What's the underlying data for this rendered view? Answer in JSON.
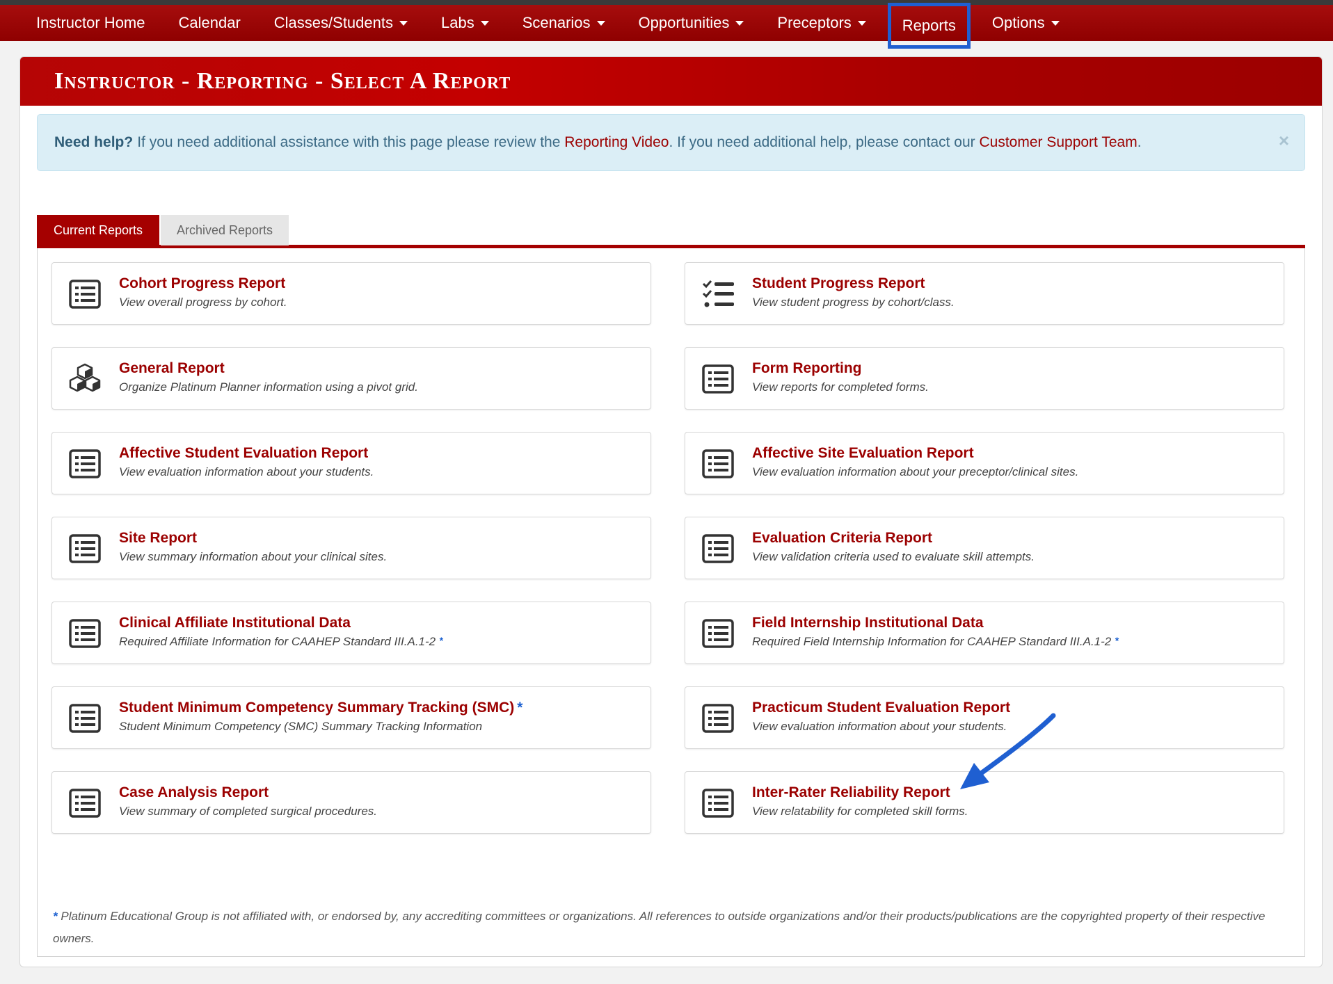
{
  "nav": {
    "items": [
      {
        "label": "Instructor Home",
        "dropdown": false
      },
      {
        "label": "Calendar",
        "dropdown": false
      },
      {
        "label": "Classes/Students",
        "dropdown": true
      },
      {
        "label": "Labs",
        "dropdown": true
      },
      {
        "label": "Scenarios",
        "dropdown": true
      },
      {
        "label": "Opportunities",
        "dropdown": true
      },
      {
        "label": "Preceptors",
        "dropdown": true
      },
      {
        "label": "Reports",
        "dropdown": false,
        "highlighted": true
      },
      {
        "label": "Options",
        "dropdown": true
      }
    ]
  },
  "page": {
    "title": "Instructor - Reporting - Select A Report"
  },
  "alert": {
    "lead": "Need help?",
    "text1": "If you need additional assistance with this page please review the",
    "link1": "Reporting Video",
    "text2": ". If you need additional help, please contact our",
    "link2": "Customer Support Team",
    "text3": ".",
    "close": "×"
  },
  "tabs": {
    "current": "Current Reports",
    "archived": "Archived Reports"
  },
  "reports": [
    {
      "title": "Cohort Progress Report",
      "desc": "View overall progress by cohort.",
      "icon": "list-alt-icon",
      "star": ""
    },
    {
      "title": "Student Progress Report",
      "desc": "View student progress by cohort/class.",
      "icon": "tasks-icon",
      "star": ""
    },
    {
      "title": "General Report",
      "desc": "Organize Platinum Planner information using a pivot grid.",
      "icon": "cubes-icon",
      "star": ""
    },
    {
      "title": "Form Reporting",
      "desc": "View reports for completed forms.",
      "icon": "list-alt-icon",
      "star": ""
    },
    {
      "title": "Affective Student Evaluation Report",
      "desc": "View evaluation information about your students.",
      "icon": "list-alt-icon",
      "star": ""
    },
    {
      "title": "Affective Site Evaluation Report",
      "desc": "View evaluation information about your preceptor/clinical sites.",
      "icon": "list-alt-icon",
      "star": ""
    },
    {
      "title": "Site Report",
      "desc": "View summary information about your clinical sites.",
      "icon": "list-alt-icon",
      "star": ""
    },
    {
      "title": "Evaluation Criteria Report",
      "desc": "View validation criteria used to evaluate skill attempts.",
      "icon": "list-alt-icon",
      "star": ""
    },
    {
      "title": "Clinical Affiliate Institutional Data",
      "desc": "Required Affiliate Information for CAAHEP Standard III.A.1-2",
      "icon": "list-alt-icon",
      "star": "",
      "desc_star": "*"
    },
    {
      "title": "Field Internship Institutional Data",
      "desc": "Required Field Internship Information for CAAHEP Standard III.A.1-2",
      "icon": "list-alt-icon",
      "star": "",
      "desc_star": "*"
    },
    {
      "title": "Student Minimum Competency Summary Tracking (SMC)",
      "desc": "Student Minimum Competency (SMC) Summary Tracking Information",
      "icon": "list-alt-icon",
      "star": "*"
    },
    {
      "title": "Practicum Student Evaluation Report",
      "desc": "View evaluation information about your students.",
      "icon": "list-alt-icon",
      "star": ""
    },
    {
      "title": "Case Analysis Report",
      "desc": "View summary of completed surgical procedures.",
      "icon": "list-alt-icon",
      "star": ""
    },
    {
      "title": "Inter-Rater Reliability Report",
      "desc": "View relatability for completed skill forms.",
      "icon": "list-alt-icon",
      "star": ""
    }
  ],
  "footnote": {
    "star": "*",
    "text": "Platinum Educational Group is not affiliated with, or endorsed by, any accrediting committees or organizations. All references to outside organizations and/or their products/publications are the copyrighted property of their respective owners."
  },
  "colors": {
    "brand_red": "#9b0000",
    "highlight_blue": "#1f5fd1",
    "alert_bg": "#dbeef6"
  }
}
